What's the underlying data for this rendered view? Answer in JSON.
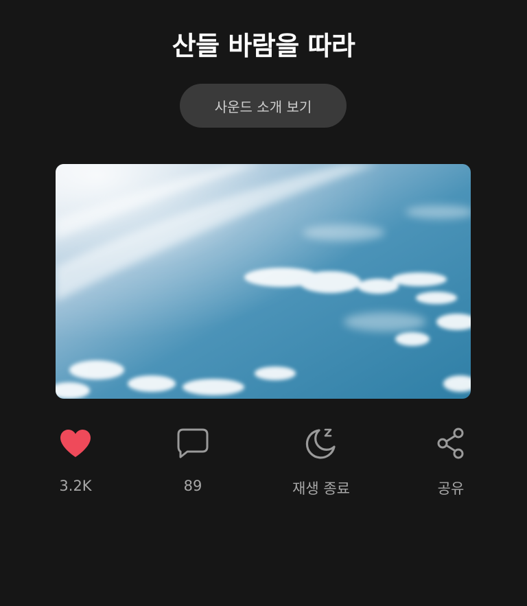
{
  "track": {
    "title": "산들 바람을 따라",
    "intro_button_label": "사운드 소개 보기",
    "artwork_icon": "sky-clouds-image"
  },
  "actions": {
    "like": {
      "icon": "heart-icon",
      "count": "3.2K",
      "color": "#ef4a5a"
    },
    "comment": {
      "icon": "comment-icon",
      "count": "89"
    },
    "sleep_timer": {
      "icon": "moon-sleep-icon",
      "label": "재생 종료"
    },
    "share": {
      "icon": "share-icon",
      "label": "공유"
    }
  },
  "colors": {
    "background": "#161616",
    "button_bg": "#3a3a3a",
    "icon_gray": "#9a9a9a",
    "label_gray": "#a8a8a8",
    "accent_red": "#ef4a5a"
  }
}
